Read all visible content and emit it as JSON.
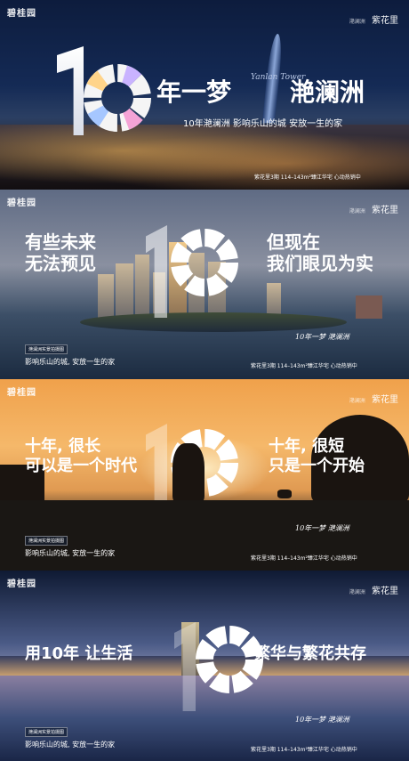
{
  "brand": {
    "logo_left": "碧桂园",
    "logo_right_small": "滟澜洲",
    "logo_right": "紫花里"
  },
  "panels": [
    {
      "big_digits": "10",
      "headline_right": "年一梦",
      "headline_name": "滟澜洲",
      "tagline": "10年滟澜洲  影响乐山的城  安放一生的家",
      "info": "紫花里3期   114–143m²臻江华宅    心动热销中",
      "tower_script": "Yanlan Tower"
    },
    {
      "headline_left_1": "有些未来",
      "headline_left_2": "无法预见",
      "headline_right_1": "但现在",
      "headline_right_2": "我们眼见为实",
      "signature": "10年一梦  滟澜洲",
      "tag": "滟澜洲实景拍摄图",
      "slogan": "影响乐山的城, 安放一生的家",
      "info": "紫花里3期   114–143m²臻江华宅    心动热销中"
    },
    {
      "headline_left_1": "十年, 很长",
      "headline_left_2": "可以是一个时代",
      "headline_right_1": "十年, 很短",
      "headline_right_2": "只是一个开始",
      "signature": "10年一梦  滟澜洲",
      "tag": "滟澜洲实景拍摄图",
      "slogan": "影响乐山的城, 安放一生的家",
      "info": "紫花里3期   114–143m²臻江华宅    心动热销中"
    },
    {
      "headline_left": "用10年 让生活",
      "headline_right": "繁华与繁花共存",
      "signature": "10年一梦  滟澜洲",
      "tag": "滟澜洲实景拍摄图",
      "slogan": "影响乐山的城, 安放一生的家",
      "info": "紫花里3期   114–143m²臻江华宅    心动热销中"
    }
  ]
}
